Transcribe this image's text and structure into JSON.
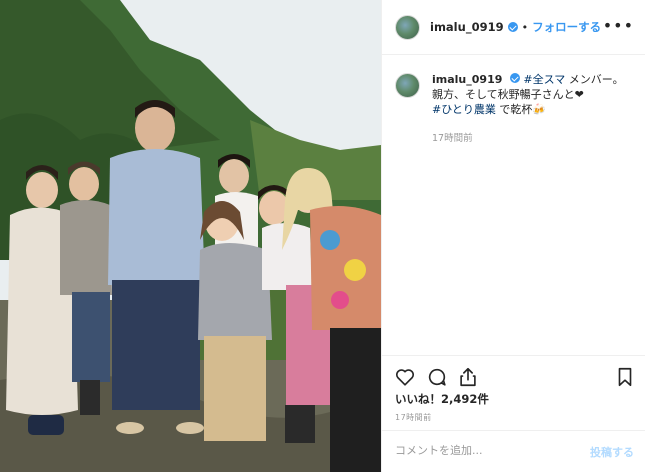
{
  "post": {
    "username": "imalu_0919",
    "separator": "•",
    "follow_label": "フォローする",
    "more_label": "•••",
    "verified_icon": "verified-badge-icon",
    "accent_color": "#3897f0"
  },
  "caption": {
    "username": "imalu_0919",
    "tag1": "#全スマ",
    "text1": " メンバー。",
    "line2": "親方、そして秋野暢子さんと❤",
    "tag2": "#ひとり農業",
    "text2": " で乾杯🍻",
    "time_ago": "17時間前"
  },
  "actions": {
    "like_icon": "heart-icon",
    "comment_icon": "comment-icon",
    "share_icon": "share-icon",
    "save_icon": "bookmark-icon",
    "likes_text": "いいね！2,492件",
    "post_time": "17時間前"
  },
  "comment": {
    "placeholder": "コメントを追加...",
    "post_label": "投稿する"
  }
}
